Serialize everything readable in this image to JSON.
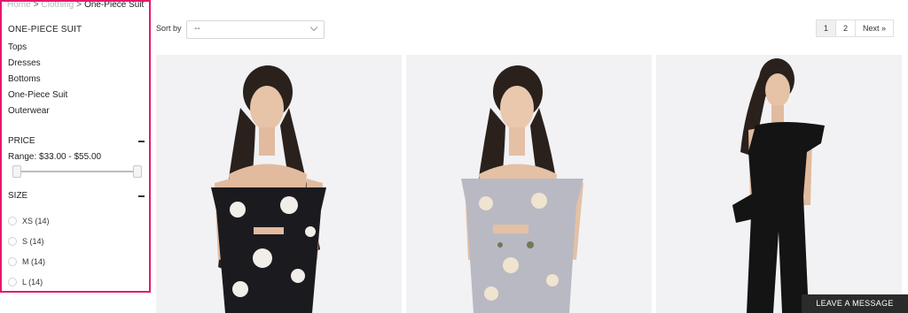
{
  "breadcrumb": {
    "home": "Home",
    "clothing": "Clothing",
    "separator": ">",
    "current": "One-Piece Suit"
  },
  "sidebar": {
    "category_title": "ONE-PIECE SUIT",
    "categories": [
      "Tops",
      "Dresses",
      "Bottoms",
      "One-Piece Suit",
      "Outerwear"
    ],
    "price": {
      "title": "PRICE",
      "range_text": "Range: $33.00 - $55.00",
      "slider_min": 0,
      "slider_max": 1
    },
    "size": {
      "title": "SIZE",
      "options": [
        "XS (14)",
        "S (14)",
        "M (14)",
        "L (14)"
      ]
    },
    "highlight_color": "#e6196e"
  },
  "toolbar": {
    "sort_label": "Sort by",
    "sort_value": "--"
  },
  "pagination": {
    "pages": [
      "1",
      "2"
    ],
    "next": "Next »",
    "active_page": "1"
  },
  "products": [
    {
      "name": "black-floral-off-shoulder-jumpsuit",
      "dress_color": "#1b1b1f",
      "flower_color": "#f1ede8"
    },
    {
      "name": "lilac-floral-off-shoulder-jumpsuit",
      "dress_color": "#b9b9c4",
      "flower_color": "#efe4cf"
    },
    {
      "name": "black-ruffle-shoulder-jumpsuit",
      "dress_color": "#141414",
      "flower_color": "#141414"
    }
  ],
  "chat": {
    "label": "LEAVE A MESSAGE"
  }
}
